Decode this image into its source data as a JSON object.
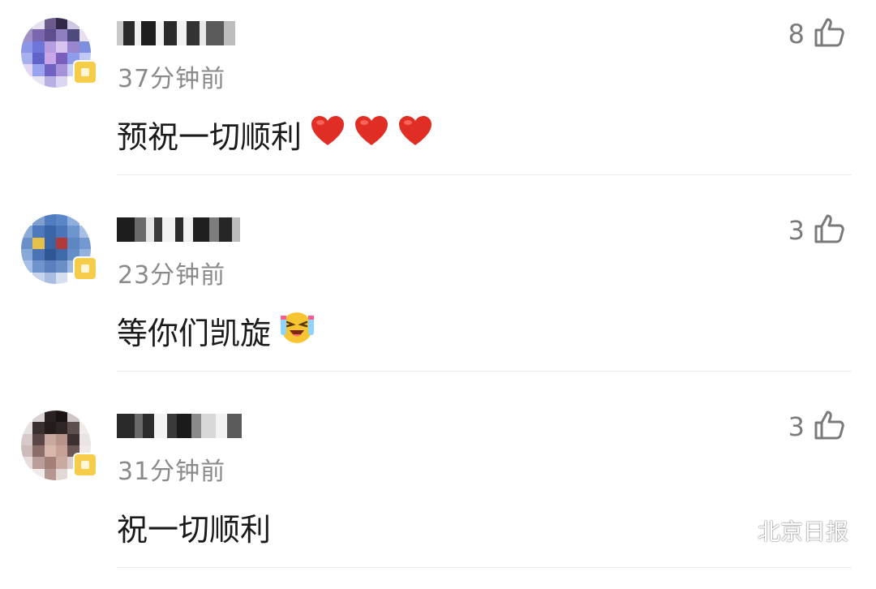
{
  "comments": [
    {
      "time": "37分钟前",
      "text": "预祝一切顺利",
      "emoji": [
        "heart",
        "heart",
        "heart"
      ],
      "likes": "8"
    },
    {
      "time": "23分钟前",
      "text": "等你们凯旋",
      "emoji": [
        "laugh-cry-face"
      ],
      "likes": "3"
    },
    {
      "time": "31分钟前",
      "text": "祝一切顺利",
      "emoji": [],
      "likes": "3"
    }
  ],
  "watermark": {
    "text": "北京日报",
    "icon": "wechat-icon"
  },
  "colors": {
    "badge": "#f6cc4b",
    "meta_text": "#8a8a8a",
    "body_text": "#1a1a1a",
    "heart": "#e02e24",
    "emoji_yellow": "#f7c531"
  }
}
